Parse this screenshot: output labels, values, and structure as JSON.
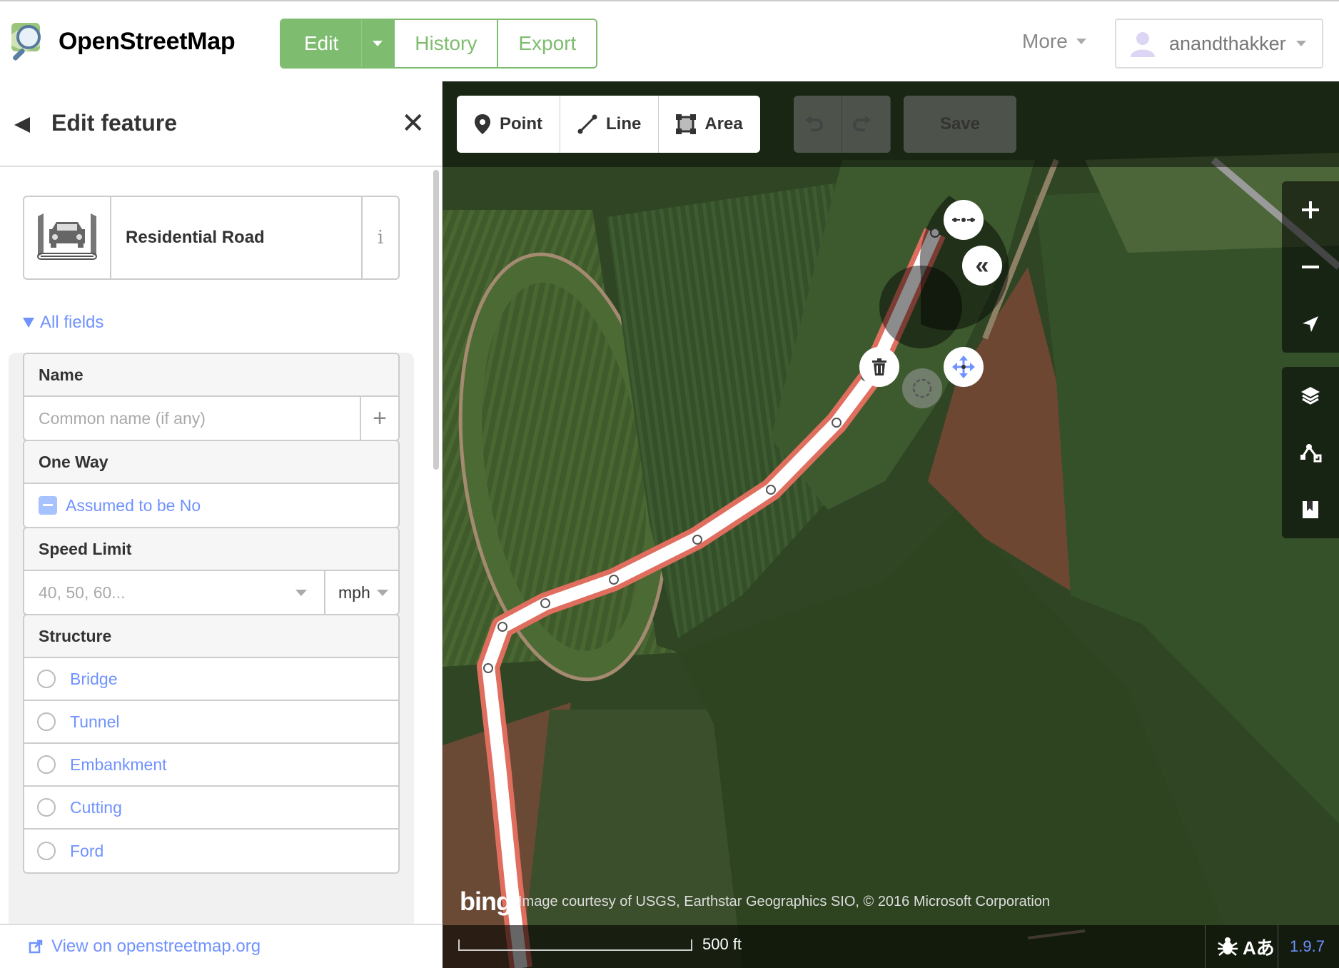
{
  "header": {
    "brand": "OpenStreetMap",
    "nav": {
      "edit": "Edit",
      "history": "History",
      "export": "Export"
    },
    "more": "More",
    "username": "anandthakker"
  },
  "sidebar": {
    "title": "Edit feature",
    "preset": {
      "name": "Residential Road",
      "info": "i"
    },
    "all_fields": "All fields",
    "fields": {
      "name": {
        "label": "Name",
        "placeholder": "Common name (if any)"
      },
      "oneway": {
        "label": "One Way",
        "value": "Assumed to be No"
      },
      "speed": {
        "label": "Speed Limit",
        "placeholder": "40, 50, 60...",
        "unit": "mph"
      },
      "structure": {
        "label": "Structure",
        "options": [
          "Bridge",
          "Tunnel",
          "Embankment",
          "Cutting",
          "Ford"
        ]
      }
    },
    "footer_link": "View on openstreetmap.org"
  },
  "map": {
    "tools": {
      "point": "Point",
      "line": "Line",
      "area": "Area",
      "save": "Save"
    },
    "attribution": {
      "logo": "bing",
      "text": "Image courtesy of USGS, Earthstar Geographics SIO, © 2016 Microsoft Corporation"
    },
    "scale": "500 ft",
    "footer_icons": "Aあ",
    "version": "1.9.7",
    "colors": {
      "selected_way": "#e06e5f",
      "accent": "#7092ff",
      "brand_green": "#7ebc6f"
    }
  },
  "icons": [
    "osm-logo-icon",
    "avatar-icon",
    "back-arrow-icon",
    "close-icon",
    "car-road-icon",
    "info-icon",
    "plus-icon",
    "minus-checkbox-icon",
    "point-icon",
    "line-icon",
    "area-icon",
    "undo-icon",
    "redo-icon",
    "zoom-in-icon",
    "zoom-out-icon",
    "geolocate-icon",
    "layers-icon",
    "map-data-icon",
    "help-icon",
    "bug-icon",
    "external-link-icon",
    "delete-icon",
    "continue-icon",
    "reverse-icon",
    "move-icon",
    "circularize-icon"
  ]
}
